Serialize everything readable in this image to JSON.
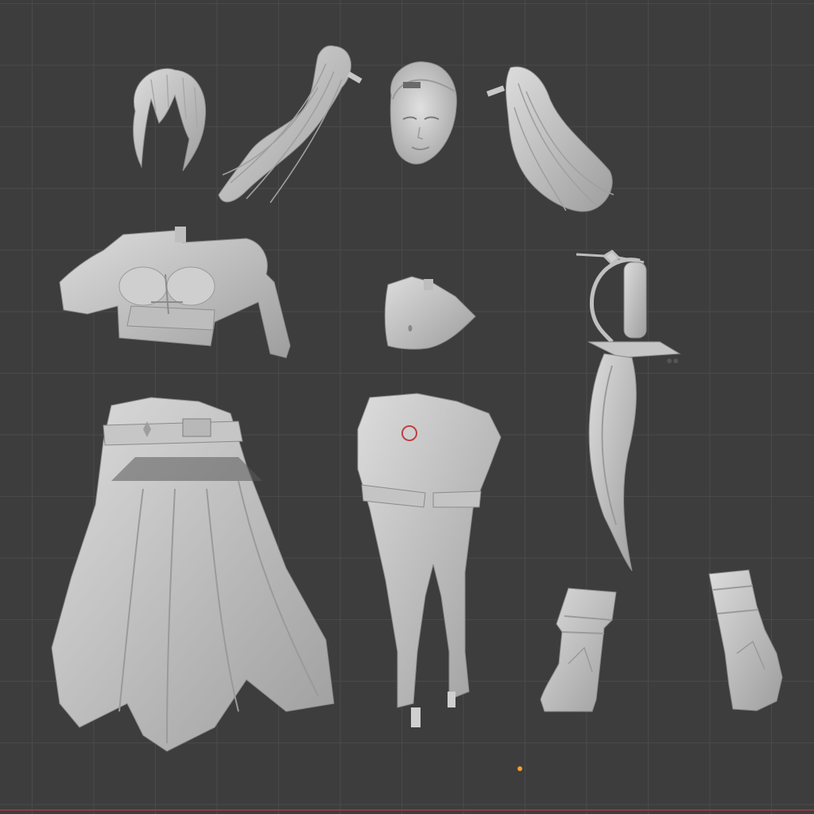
{
  "app": "3D viewport",
  "view": {
    "background": "#3d3d3d",
    "grid_color": "#4a4a4a",
    "x_axis_color": "#8a3c44",
    "origin_color": "#f0a030",
    "model_color": "#c9c9c9"
  },
  "parts": [
    "hair-bangs",
    "hair-ponytail-left",
    "head",
    "hair-ponytail-right",
    "jacket-top",
    "torso-midriff",
    "saber-sword",
    "skirt-belt",
    "legs-shorts-stockings",
    "boot-left",
    "boot-right"
  ]
}
